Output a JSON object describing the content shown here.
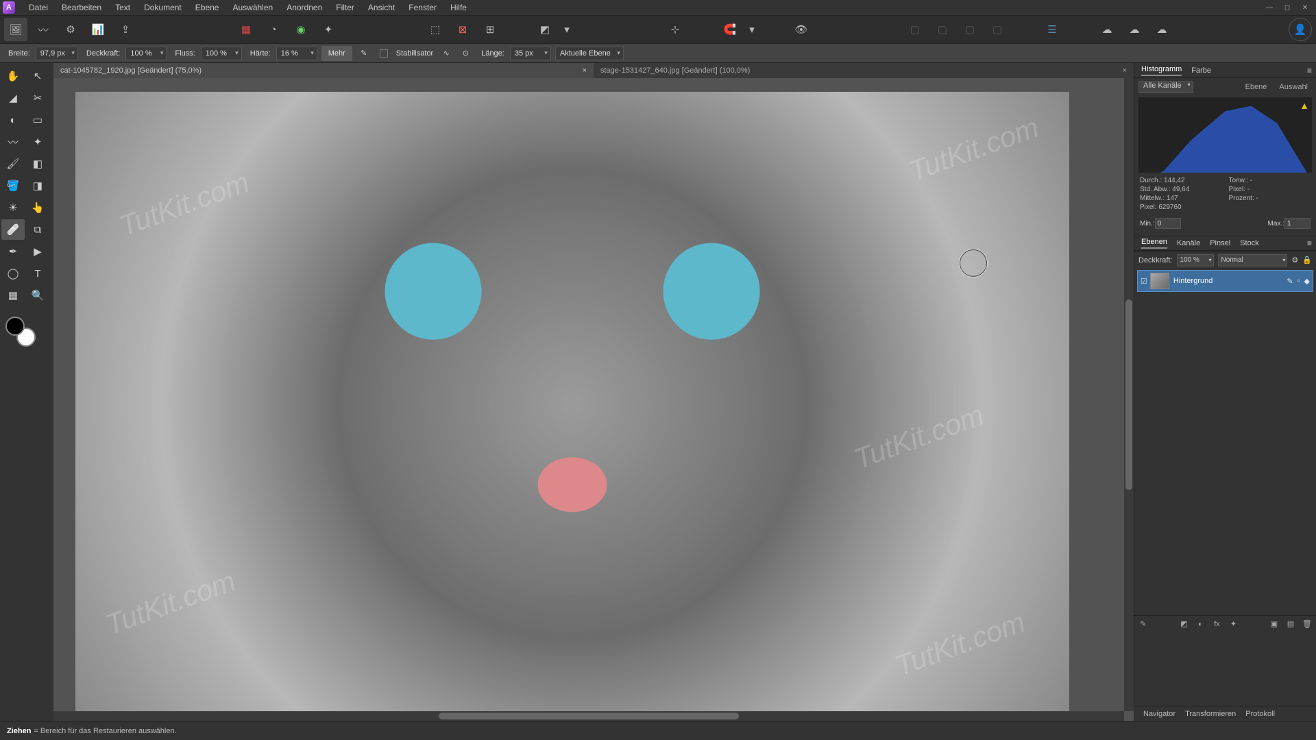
{
  "menu": [
    "Datei",
    "Bearbeiten",
    "Text",
    "Dokument",
    "Ebene",
    "Auswählen",
    "Anordnen",
    "Filter",
    "Ansicht",
    "Fenster",
    "Hilfe"
  ],
  "context": {
    "breite_label": "Breite:",
    "breite": "97,9 px",
    "deckkraft_label": "Deckkraft:",
    "deckkraft": "100 %",
    "fluss_label": "Fluss:",
    "fluss": "100 %",
    "haerte_label": "Härte:",
    "haerte": "16 %",
    "mehr": "Mehr",
    "stabilisator": "Stabilisator",
    "laenge_label": "Länge:",
    "laenge": "35 px",
    "ziel": "Aktuelle Ebene"
  },
  "tabs": [
    {
      "label": "cat-1045782_1920.jpg [Geändert] (75,0%)",
      "active": true
    },
    {
      "label": "stage-1531427_640.jpg [Geändert] (100,0%)",
      "active": false
    }
  ],
  "histogram": {
    "tab_hist": "Histogramm",
    "tab_color": "Farbe",
    "channel": "Alle Kanäle",
    "ebene": "Ebene",
    "auswahl": "Auswahl",
    "stats": {
      "durch": "Durch.: 144,42",
      "tonw": "Tonw.: -",
      "std": "Std. Abw.: 49,64",
      "pixelr": "Pixel: -",
      "mittelw": "Mittelw.: 147",
      "prozent": "Prozent: -",
      "pixel": "Pixel: 629760"
    },
    "min_label": "Min.:",
    "min": "0",
    "max_label": "Max.:",
    "max": "1"
  },
  "layers": {
    "tab_ebenen": "Ebenen",
    "tab_kanaele": "Kanäle",
    "tab_pinsel": "Pinsel",
    "tab_stock": "Stock",
    "deckkraft_label": "Deckkraft:",
    "deckkraft": "100 %",
    "blend": "Normal",
    "layer_name": "Hintergrund"
  },
  "bottom_tabs": [
    "Navigator",
    "Transformieren",
    "Protokoll"
  ],
  "status": {
    "strong": "Ziehen",
    "help": " = Bereich für das Restaurieren auswählen."
  },
  "watermark": "TutKit.com"
}
